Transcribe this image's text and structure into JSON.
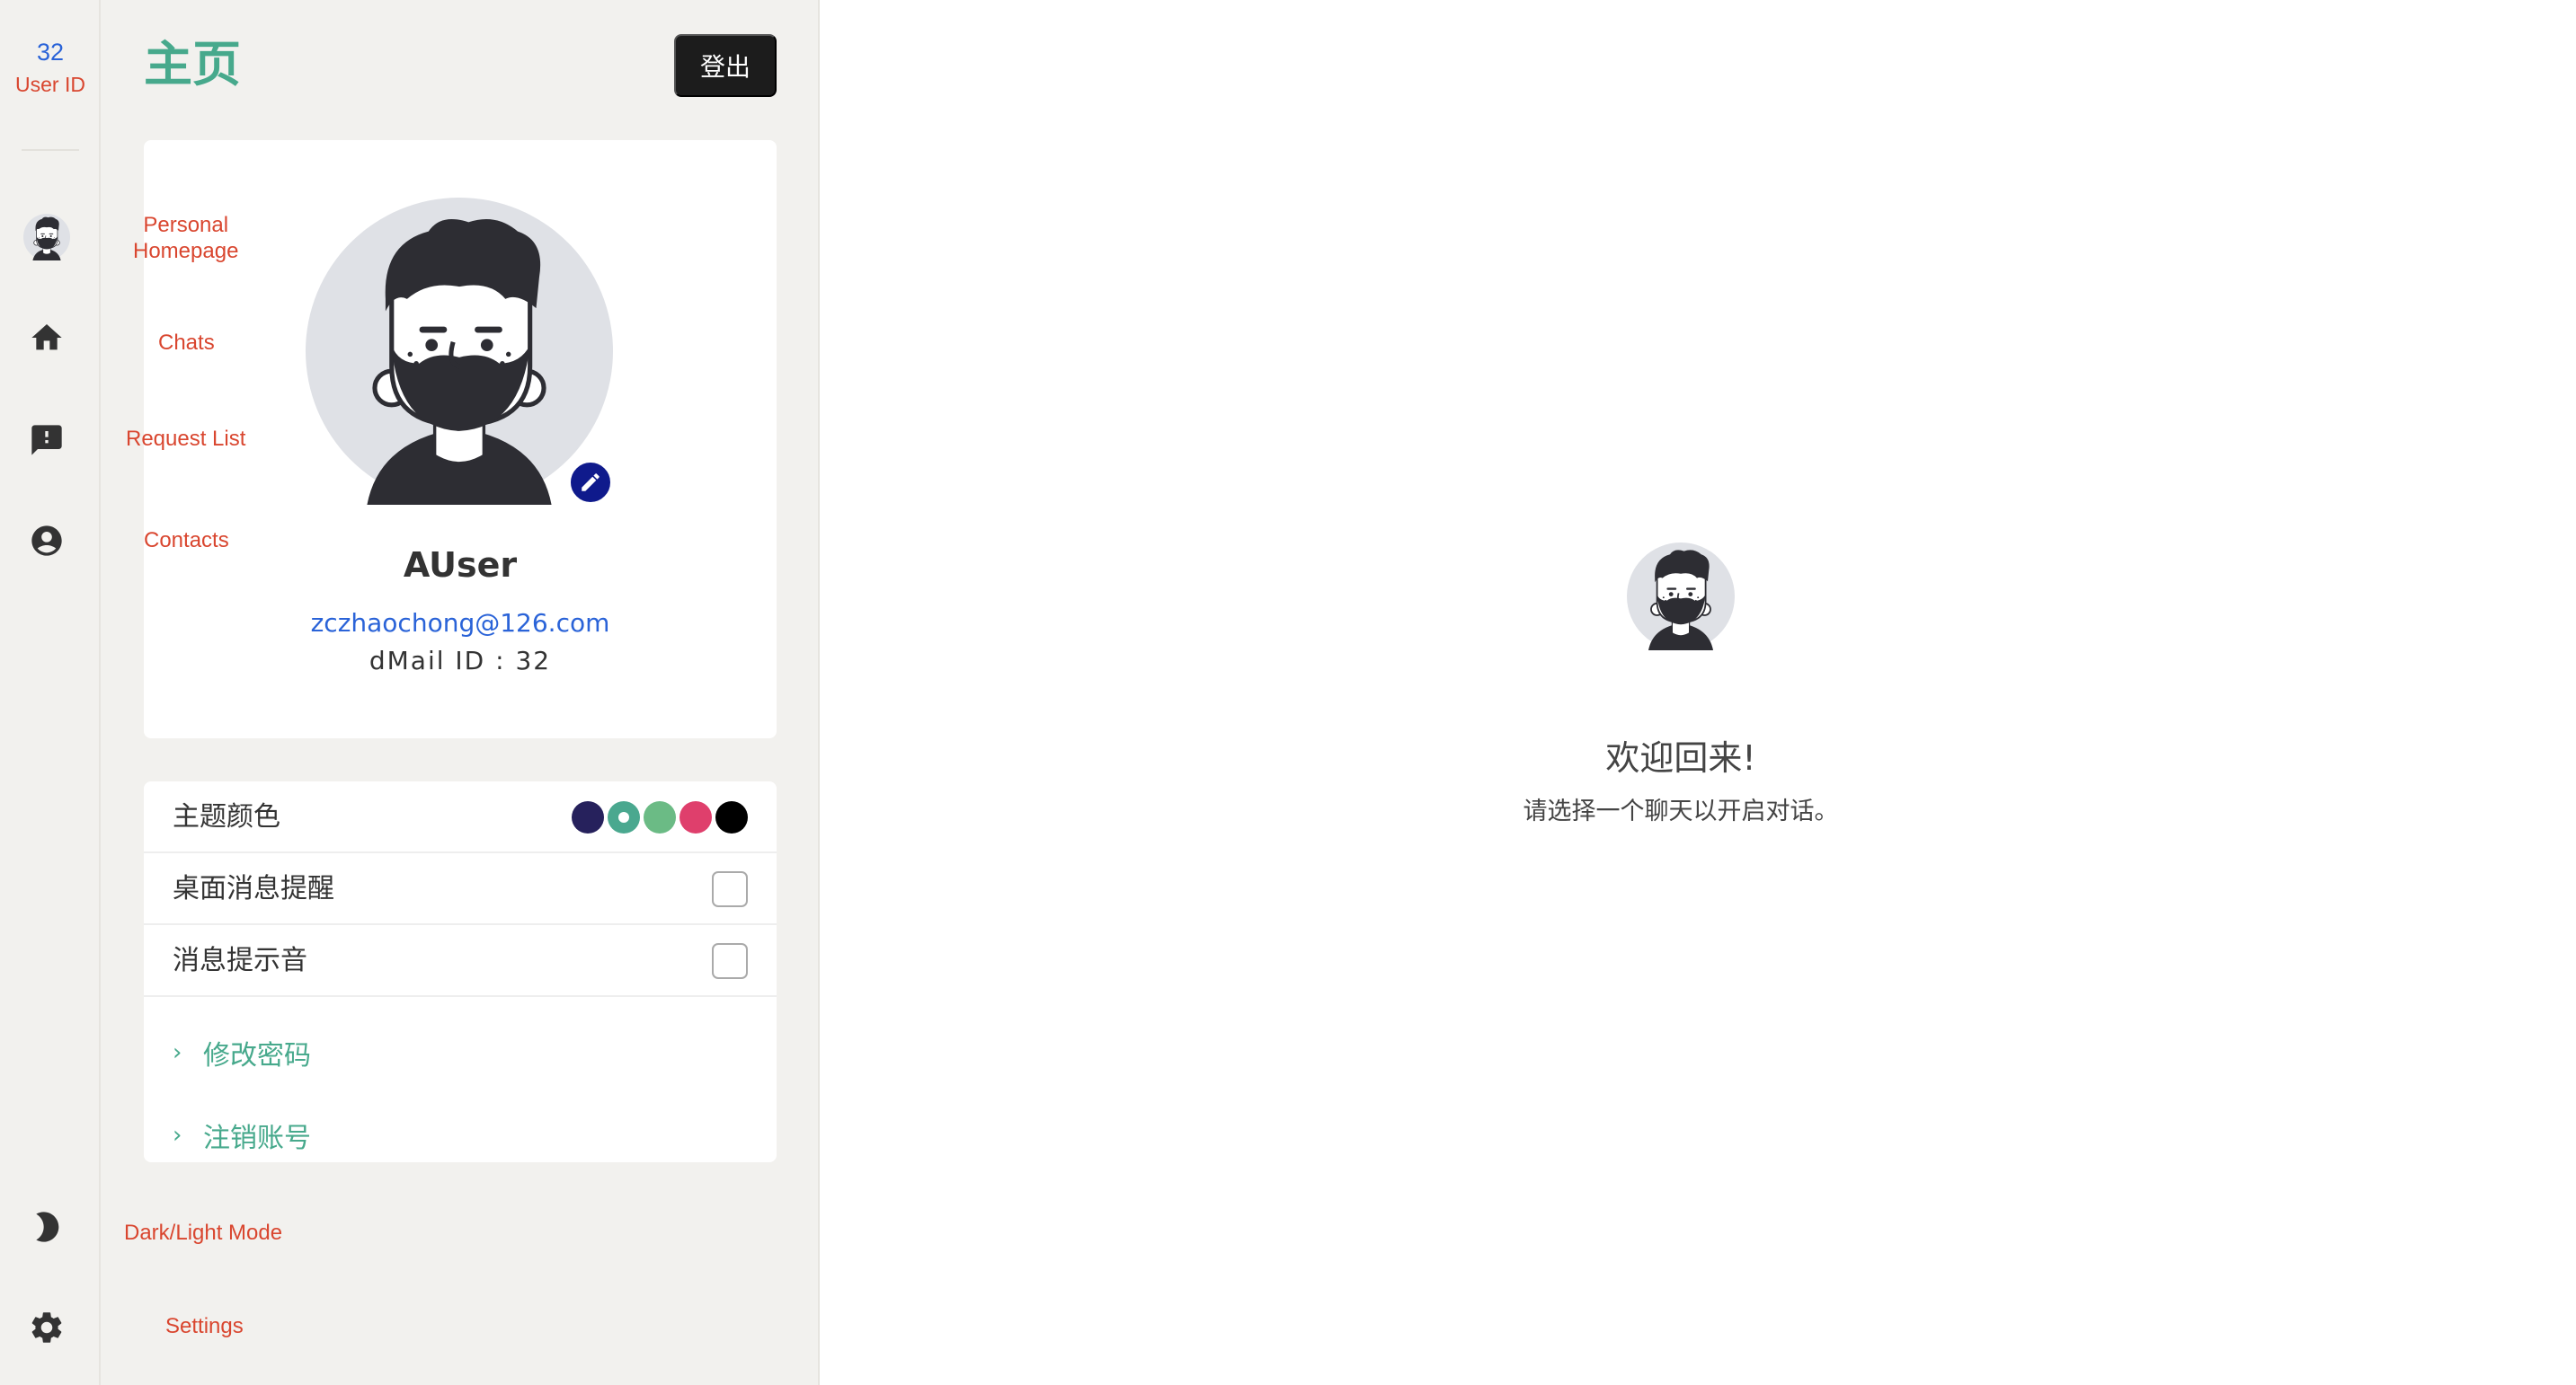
{
  "rail": {
    "user_id_value": "32",
    "user_id_label": "User ID",
    "items": [
      {
        "name": "avatar",
        "label": "Personal\nHomepage"
      },
      {
        "name": "home-icon",
        "label": "Chats"
      },
      {
        "name": "feedback-icon",
        "label": "Request List"
      },
      {
        "name": "account-circle-icon",
        "label": "Contacts"
      }
    ],
    "dark_mode_label": "Dark/Light Mode",
    "settings_label": "Settings"
  },
  "panel": {
    "title": "主页",
    "logout_label": "登出",
    "profile": {
      "name": "AUser",
      "email": "zczhaochong@126.com",
      "dmail_id": "dMail ID : 32"
    },
    "settings": {
      "theme_color_label": "主题颜色",
      "theme_colors": [
        "#26215c",
        "#4aa88f",
        "#6bbb85",
        "#df3f6c",
        "#000000"
      ],
      "selected_theme_index": 1,
      "desktop_notify_label": "桌面消息提醒",
      "desktop_notify_checked": false,
      "sound_label": "消息提示音",
      "sound_checked": false,
      "change_password_label": "修改密码",
      "deactivate_label": "注销账号"
    }
  },
  "main": {
    "welcome_title": "欢迎回来!",
    "welcome_subtitle": "请选择一个聊天以开启对话。"
  }
}
